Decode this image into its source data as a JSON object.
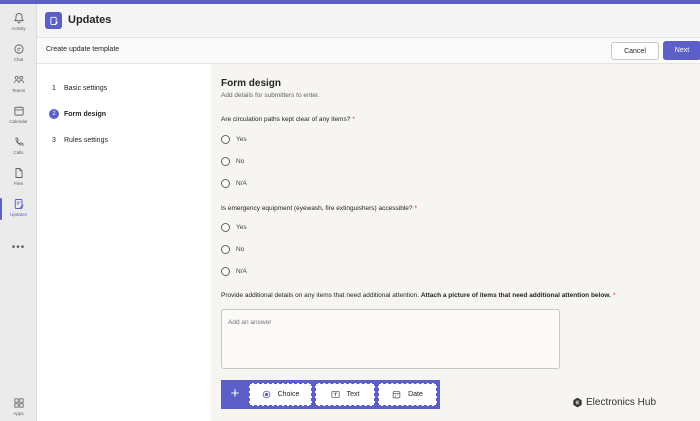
{
  "rail": {
    "items": [
      {
        "label": "Activity",
        "icon": "bell-icon"
      },
      {
        "label": "Chat",
        "icon": "chat-icon"
      },
      {
        "label": "Teams",
        "icon": "teams-icon"
      },
      {
        "label": "Calendar",
        "icon": "calendar-icon"
      },
      {
        "label": "Calls",
        "icon": "phone-icon"
      },
      {
        "label": "Files",
        "icon": "file-icon"
      },
      {
        "label": "Updates",
        "icon": "updates-icon"
      }
    ],
    "more": "•••",
    "apps_label": "Apps"
  },
  "header": {
    "title": "Updates"
  },
  "subheader": {
    "title": "Create update template",
    "cancel_label": "Cancel",
    "next_label": "Next"
  },
  "steps": [
    {
      "num": "1",
      "label": "Basic settings"
    },
    {
      "num": "2",
      "label": "Form design"
    },
    {
      "num": "3",
      "label": "Rules settings"
    }
  ],
  "form": {
    "title": "Form design",
    "subtitle": "Add details for submitters to enter.",
    "q1": {
      "text": "Are circulation paths kept clear of any items?",
      "req": "*",
      "options": [
        "Yes",
        "No",
        "N/A"
      ]
    },
    "q2": {
      "text": "Is emergency equipment (eyewash, fire extinguishers) accessible?",
      "req": "*",
      "options": [
        "Yes",
        "No",
        "N/A"
      ]
    },
    "q3": {
      "text": "Provide additional details on any items that need additional attention.",
      "bold": "Attach a picture of items that need additional attention below.",
      "req": "*"
    },
    "answer_placeholder": "Add an answer"
  },
  "toolbar": {
    "add_label": "+",
    "choice_label": "Choice",
    "text_label": "Text",
    "date_label": "Date"
  },
  "watermark": {
    "text": "Electronics Hub"
  },
  "colors": {
    "accent": "#5b5fc7",
    "required": "#c4314b"
  }
}
